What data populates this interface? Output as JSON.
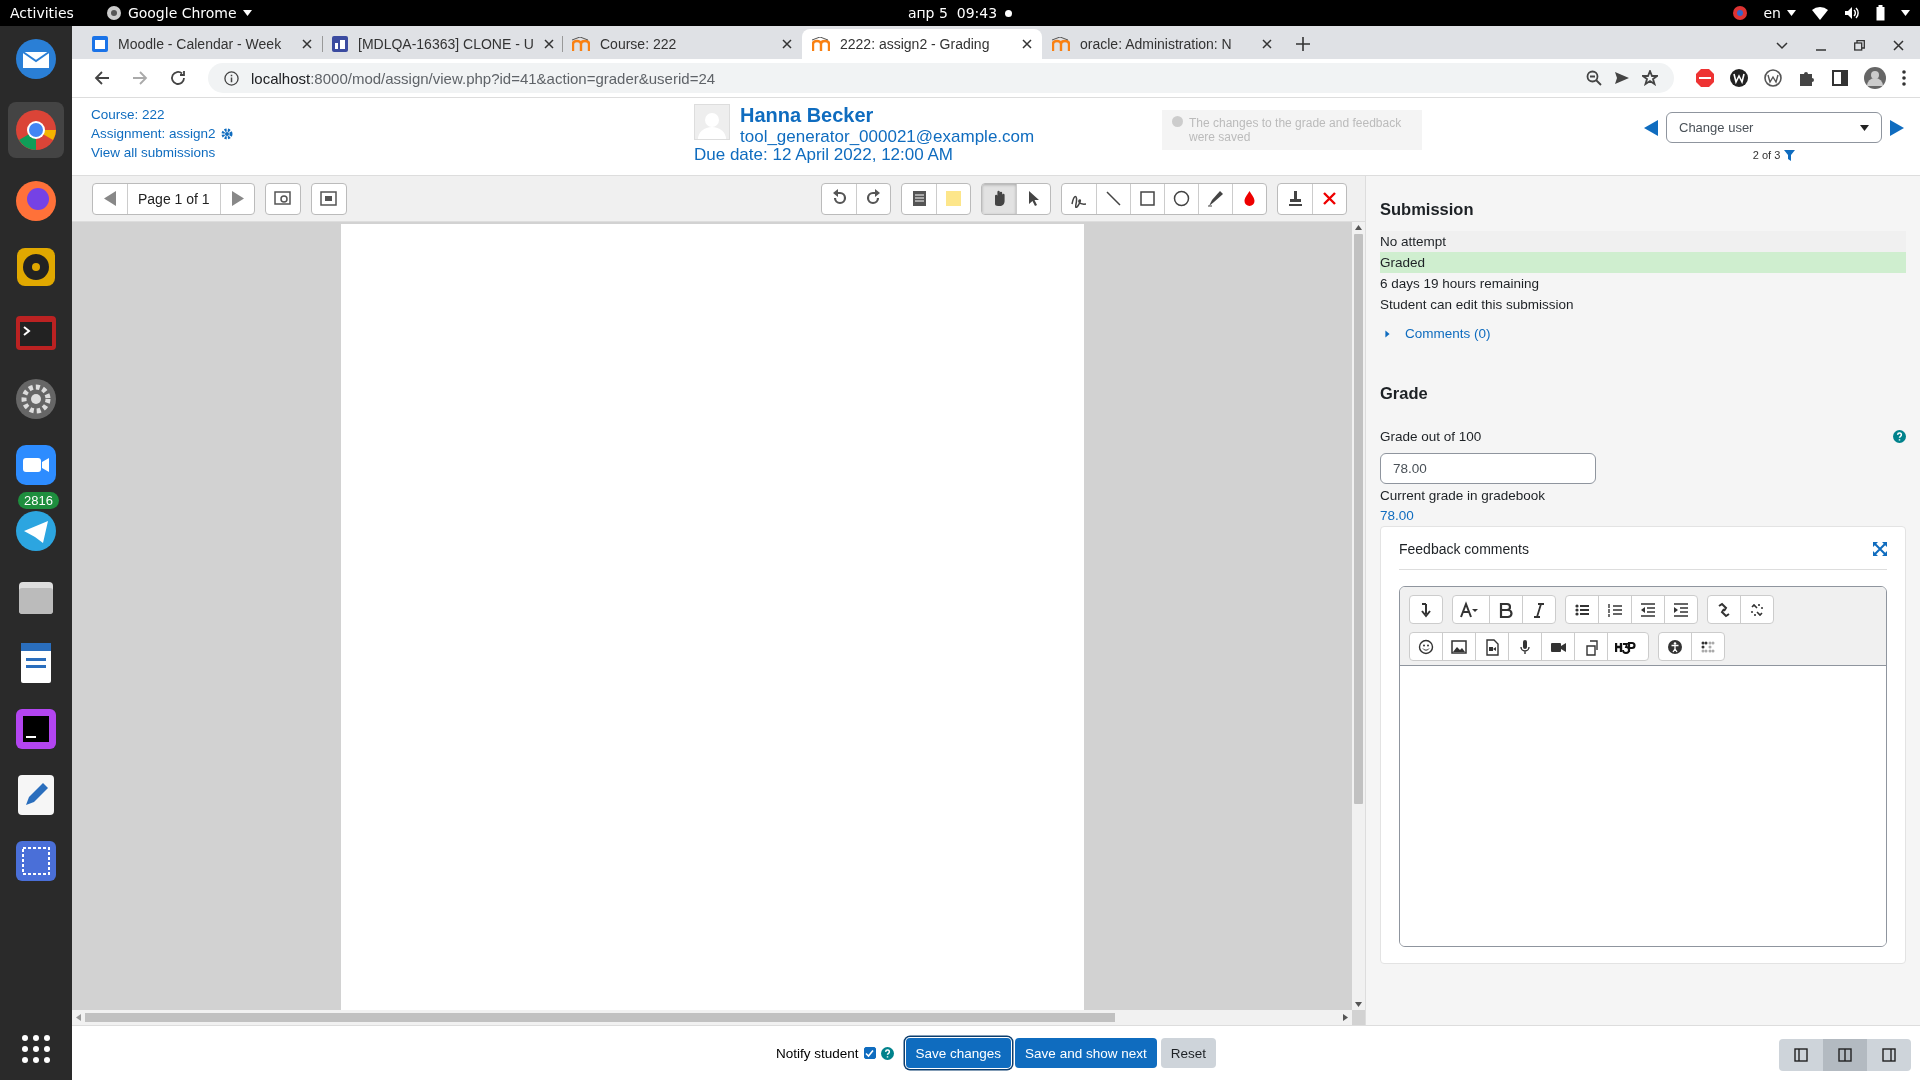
{
  "topbar": {
    "activities": "Activities",
    "app": "Google Chrome",
    "clock": "апр 5  09:43",
    "language": "en"
  },
  "dock": {
    "badge": "2816"
  },
  "tabs": [
    {
      "title": "Moodle - Calendar - Week",
      "selected": false,
      "kind": "calendar"
    },
    {
      "title": "[MDLQA-16363] CLONE - U",
      "selected": false,
      "kind": "tracker"
    },
    {
      "title": "Course: 222",
      "selected": false,
      "kind": "moodle"
    },
    {
      "title": "2222: assign2 - Grading",
      "selected": true,
      "kind": "moodle"
    },
    {
      "title": "oracle: Administration: N",
      "selected": false,
      "kind": "moodle"
    }
  ],
  "address": {
    "host": "localhost",
    "path": ":8000/mod/assign/view.php?id=41&action=grader&userid=24"
  },
  "header": {
    "links": [
      "Course: 222",
      "Assignment: assign2",
      "View all submissions"
    ],
    "user_name": "Hanna Becker",
    "user_email": "tool_generator_000021@example.com",
    "due_date": "Due date: 12 April 2022, 12:00 AM",
    "notice": "The changes to the grade and feedback were saved",
    "change_user": "Change user",
    "counter": "2 of 3"
  },
  "pdf_toolbar": {
    "page": "Page 1 of 1",
    "tool_groups": [
      {
        "tools": [
          {
            "kind": "pan",
            "selected": true
          },
          {
            "kind": "select",
            "selected": false
          }
        ]
      },
      {
        "tools": [
          {
            "kind": "pen",
            "selected": false
          },
          {
            "kind": "line",
            "selected": false
          },
          {
            "kind": "rectangle",
            "selected": false
          },
          {
            "kind": "oval",
            "selected": false
          },
          {
            "kind": "highlight",
            "selected": false
          },
          {
            "kind": "color",
            "selected": false
          }
        ]
      },
      {
        "tools": [
          {
            "kind": "stamp",
            "selected": false
          },
          {
            "kind": "delete",
            "selected": false
          }
        ]
      }
    ]
  },
  "submission": {
    "title": "Submission",
    "statuses": [
      {
        "text": "No attempt",
        "kind": "neutral"
      },
      {
        "text": "Graded",
        "kind": "success"
      },
      {
        "text": "6 days 19 hours remaining",
        "kind": "plain"
      },
      {
        "text": "Student can edit this submission",
        "kind": "plain"
      }
    ],
    "comments": {
      "label": "Comments (0)",
      "expanded": false
    }
  },
  "grade": {
    "title": "Grade",
    "label": "Grade out of 100",
    "value": "78.00",
    "current_label": "Current grade in gradebook",
    "current_value": "78.00"
  },
  "feedback": {
    "title": "Feedback comments"
  },
  "footer": {
    "notify_label": "Notify student",
    "notify_checked": true,
    "buttons": [
      {
        "label": "Save changes",
        "kind": "focused"
      },
      {
        "label": "Save and show next",
        "kind": "primary"
      },
      {
        "label": "Reset",
        "kind": "secondary"
      }
    ],
    "layouts": [
      {
        "kind": "grader",
        "selected": false
      },
      {
        "kind": "split",
        "selected": true
      },
      {
        "kind": "review",
        "selected": false
      }
    ]
  }
}
